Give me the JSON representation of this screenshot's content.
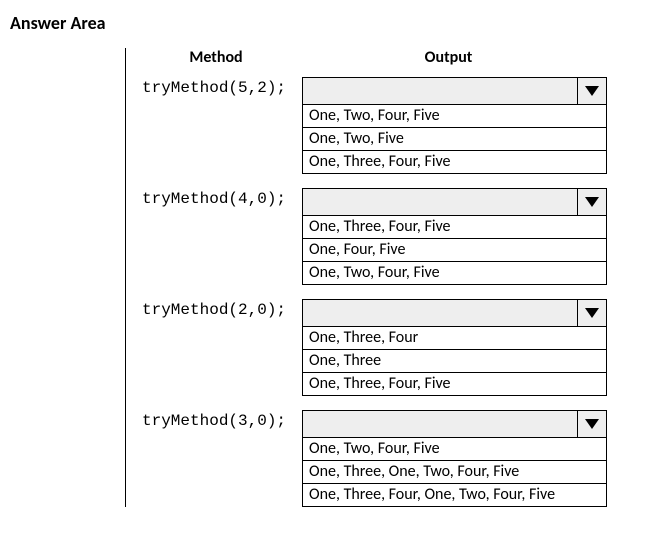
{
  "title": "Answer Area",
  "headers": {
    "method": "Method",
    "output": "Output"
  },
  "rows": [
    {
      "method": "tryMethod(5,2);",
      "selected": "",
      "options": [
        "One, Two, Four, Five",
        "One, Two, Five",
        "One, Three, Four, Five"
      ]
    },
    {
      "method": "tryMethod(4,0);",
      "selected": "",
      "options": [
        "One, Three, Four, Five",
        "One, Four, Five",
        "One, Two, Four, Five"
      ]
    },
    {
      "method": "tryMethod(2,0);",
      "selected": "",
      "options": [
        "One, Three, Four",
        "One, Three",
        "One, Three, Four, Five"
      ]
    },
    {
      "method": "tryMethod(3,0);",
      "selected": "",
      "options": [
        "One, Two, Four, Five",
        "One, Three, One, Two, Four, Five",
        "One, Three, Four, One, Two, Four, Five"
      ]
    }
  ]
}
